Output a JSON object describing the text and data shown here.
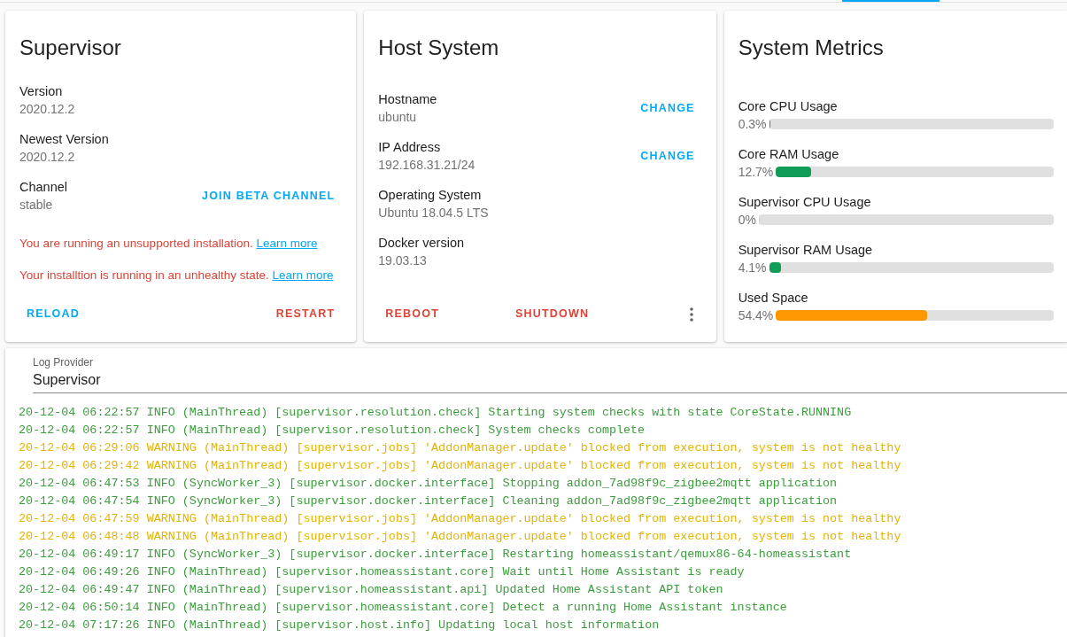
{
  "supervisor": {
    "title": "Supervisor",
    "fields": [
      {
        "label": "Version",
        "value": "2020.12.2"
      },
      {
        "label": "Newest Version",
        "value": "2020.12.2"
      },
      {
        "label": "Channel",
        "value": "stable",
        "action": "JOIN BETA CHANNEL"
      }
    ],
    "warnings": [
      {
        "text": "You are running an unsupported installation.",
        "link": "Learn more"
      },
      {
        "text": "Your installtion is running in an unhealthy state.",
        "link": "Learn more"
      }
    ],
    "buttons": [
      {
        "label": "RELOAD",
        "kind": "primary"
      },
      {
        "label": "RESTART",
        "kind": "danger"
      }
    ]
  },
  "host": {
    "title": "Host System",
    "fields": [
      {
        "label": "Hostname",
        "value": "ubuntu",
        "action": "CHANGE"
      },
      {
        "label": "IP Address",
        "value": "192.168.31.21/24",
        "action": "CHANGE"
      },
      {
        "label": "Operating System",
        "value": "Ubuntu 18.04.5 LTS"
      },
      {
        "label": "Docker version",
        "value": "19.03.13"
      }
    ],
    "buttons": [
      {
        "label": "REBOOT",
        "kind": "danger"
      },
      {
        "label": "SHUTDOWN",
        "kind": "danger"
      }
    ]
  },
  "metrics": {
    "title": "System Metrics",
    "items": [
      {
        "label": "Core CPU Usage",
        "reading": "0.3%",
        "level": 0.003,
        "color": "#0f9d58"
      },
      {
        "label": "Core RAM Usage",
        "reading": "12.7%",
        "level": 0.127,
        "color": "#0f9d58"
      },
      {
        "label": "Supervisor CPU Usage",
        "reading": "0%",
        "level": 0
      },
      {
        "label": "Supervisor RAM Usage",
        "reading": "4.1%",
        "level": 0.041,
        "color": "#0f9d58"
      },
      {
        "label": "Used Space",
        "reading": "54.4%",
        "level": 0.544,
        "color": "#ff9800"
      }
    ]
  },
  "log": {
    "provider_label": "Log Provider",
    "provider": "Supervisor",
    "lines": [
      {
        "kind": "info",
        "text": "20-12-04 06:22:57 INFO (MainThread) [supervisor.resolution.check] Starting system checks with state CoreState.RUNNING"
      },
      {
        "kind": "info",
        "text": "20-12-04 06:22:57 INFO (MainThread) [supervisor.resolution.check] System checks complete"
      },
      {
        "kind": "warning",
        "text": "20-12-04 06:29:06 WARNING (MainThread) [supervisor.jobs] 'AddonManager.update' blocked from execution, system is not healthy"
      },
      {
        "kind": "warning",
        "text": "20-12-04 06:29:42 WARNING (MainThread) [supervisor.jobs] 'AddonManager.update' blocked from execution, system is not healthy"
      },
      {
        "kind": "info",
        "text": "20-12-04 06:47:53 INFO (SyncWorker_3) [supervisor.docker.interface] Stopping addon_7ad98f9c_zigbee2mqtt application"
      },
      {
        "kind": "info",
        "text": "20-12-04 06:47:54 INFO (SyncWorker_3) [supervisor.docker.interface] Cleaning addon_7ad98f9c_zigbee2mqtt application"
      },
      {
        "kind": "warning",
        "text": "20-12-04 06:47:59 WARNING (MainThread) [supervisor.jobs] 'AddonManager.update' blocked from execution, system is not healthy"
      },
      {
        "kind": "warning",
        "text": "20-12-04 06:48:48 WARNING (MainThread) [supervisor.jobs] 'AddonManager.update' blocked from execution, system is not healthy"
      },
      {
        "kind": "info",
        "text": "20-12-04 06:49:17 INFO (SyncWorker_3) [supervisor.docker.interface] Restarting homeassistant/qemux86-64-homeassistant"
      },
      {
        "kind": "info",
        "text": "20-12-04 06:49:26 INFO (MainThread) [supervisor.homeassistant.core] Wait until Home Assistant is ready"
      },
      {
        "kind": "info",
        "text": "20-12-04 06:49:47 INFO (MainThread) [supervisor.homeassistant.api] Updated Home Assistant API token"
      },
      {
        "kind": "info",
        "text": "20-12-04 06:50:14 INFO (MainThread) [supervisor.homeassistant.core] Detect a running Home Assistant instance"
      },
      {
        "kind": "info",
        "text": "20-12-04 07:17:26 INFO (MainThread) [supervisor.host.info] Updating local host information"
      }
    ]
  }
}
